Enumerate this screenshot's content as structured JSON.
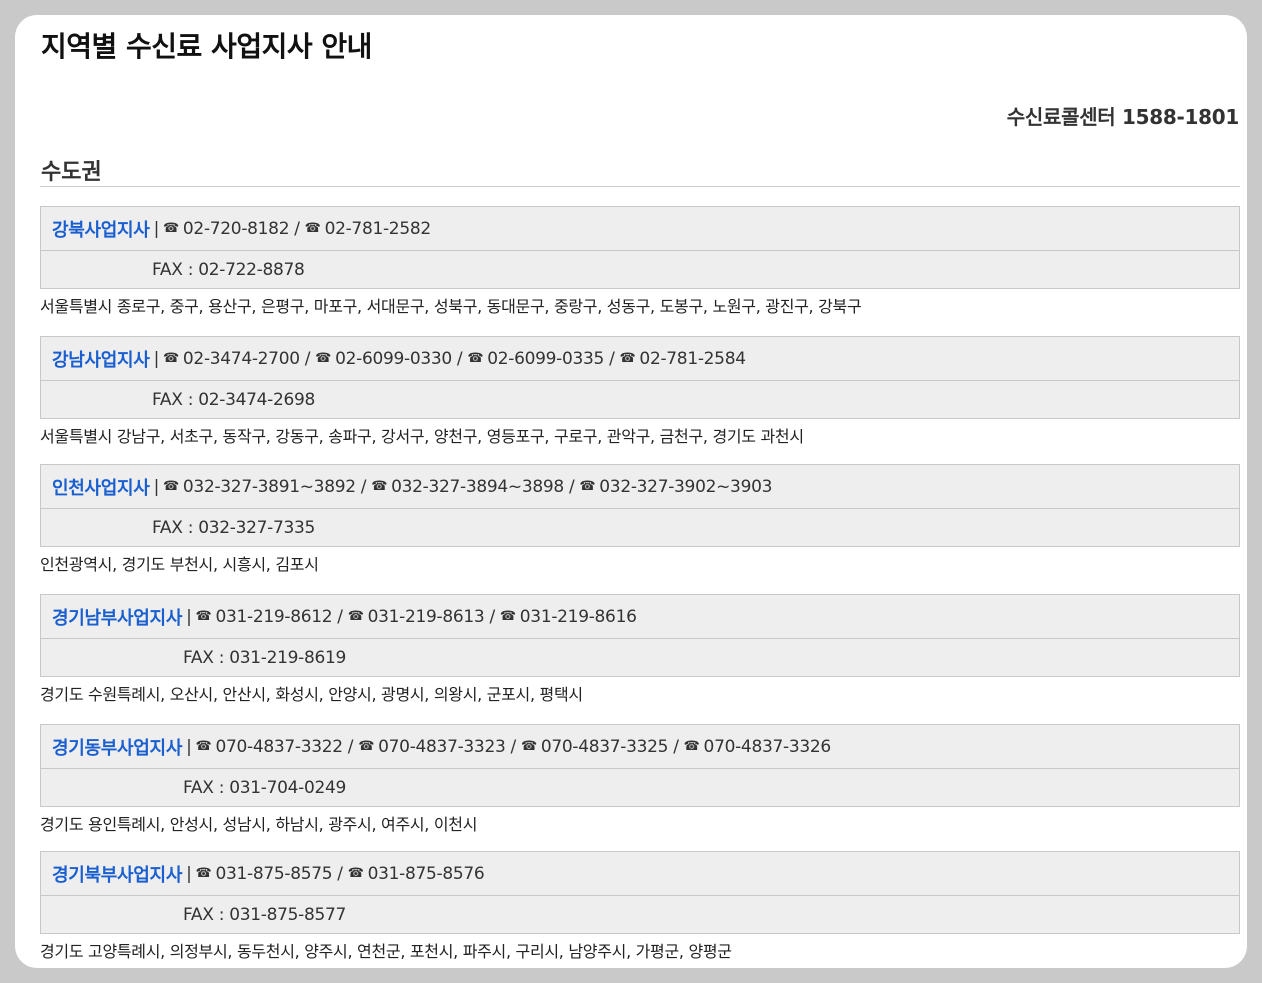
{
  "page": {
    "title": "지역별 수신료 사업지사 안내",
    "call_center": "수신료콜센터 1588-1801"
  },
  "region": {
    "title": "수도권"
  },
  "offices": [
    {
      "name": "강북사업지사",
      "phones": [
        "02-720-8182",
        "02-781-2582"
      ],
      "fax": "FAX : 02-722-8878",
      "areas": "서울특별시 종로구, 중구, 용산구, 은평구, 마포구, 서대문구, 성북구, 동대문구, 중랑구, 성동구, 도봉구, 노원구, 광진구, 강북구"
    },
    {
      "name": "강남사업지사",
      "phones": [
        "02-3474-2700",
        "02-6099-0330",
        "02-6099-0335",
        "02-781-2584"
      ],
      "fax": "FAX : 02-3474-2698",
      "areas": "서울특별시 강남구, 서초구, 동작구, 강동구, 송파구, 강서구, 양천구, 영등포구, 구로구, 관악구, 금천구, 경기도 과천시"
    },
    {
      "name": "인천사업지사",
      "phones": [
        "032-327-3891~3892",
        "032-327-3894~3898",
        "032-327-3902~3903"
      ],
      "fax": "FAX : 032-327-7335",
      "areas": "인천광역시, 경기도 부천시, 시흥시, 김포시"
    },
    {
      "name": "경기남부사업지사",
      "phones": [
        "031-219-8612",
        "031-219-8613",
        "031-219-8616"
      ],
      "fax": "FAX : 031-219-8619",
      "areas": "경기도 수원특례시, 오산시, 안산시, 화성시, 안양시, 광명시, 의왕시, 군포시, 평택시"
    },
    {
      "name": "경기동부사업지사",
      "phones": [
        "070-4837-3322",
        "070-4837-3323",
        "070-4837-3325",
        "070-4837-3326"
      ],
      "fax": "FAX : 031-704-0249",
      "areas": "경기도 용인특례시, 안성시, 성남시, 하남시, 광주시, 여주시, 이천시"
    },
    {
      "name": "경기북부사업지사",
      "phones": [
        "031-875-8575",
        "031-875-8576"
      ],
      "fax": "FAX : 031-875-8577",
      "areas": "경기도 고양특례시, 의정부시, 동두천시, 양주시, 연천군, 포천시, 파주시, 구리시, 남양주시, 가평군, 양평군"
    }
  ],
  "separators": {
    "name_divider": "|",
    "phone_divider": "/",
    "phone_symbol": "☎"
  },
  "icons": {
    "phone": "phone-icon"
  },
  "colors": {
    "office_name": "#1a5fd0",
    "box_background": "#eeeeee",
    "page_background": "#c9c9c9"
  }
}
